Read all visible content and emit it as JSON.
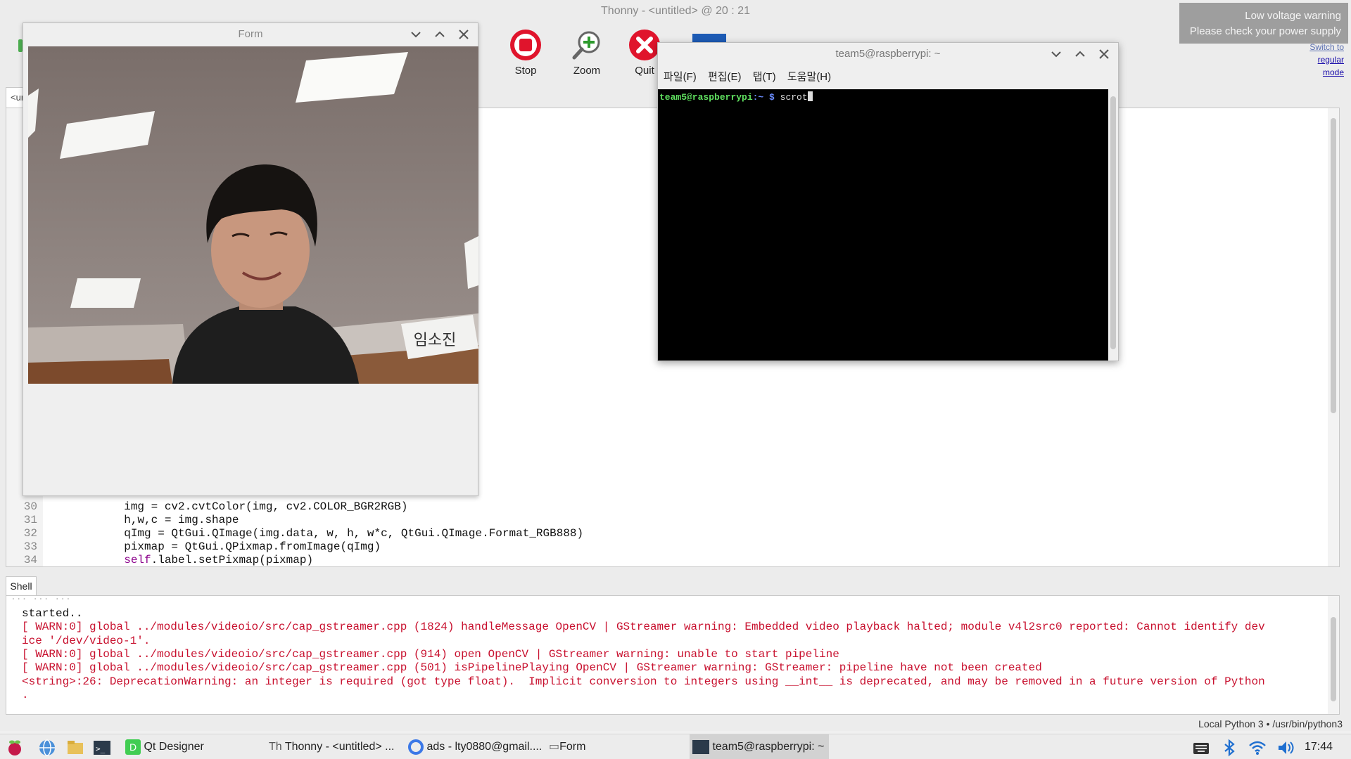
{
  "thonny": {
    "title": "Thonny  -  <untitled>  @  20 : 21",
    "toolbar": {
      "stop": "Stop",
      "zoom": "Zoom",
      "quit": "Quit"
    },
    "editor_tab": "<untitled>",
    "code": [
      {
        "n": "30",
        "text": "            img = cv2.cvtColor(img, cv2.COLOR_BGR2RGB)"
      },
      {
        "n": "31",
        "text": "            h,w,c = img.shape"
      },
      {
        "n": "32",
        "text": "            qImg = QtGui.QImage(img.data, w, h, w*c, QtGui.QImage.Format_RGB888)"
      },
      {
        "n": "33",
        "text": "            pixmap = QtGui.QPixmap.fromImage(qImg)"
      },
      {
        "n": "34",
        "kw": "self",
        "text": ".label.setPixmap(pixmap)"
      }
    ],
    "shell_tab": "Shell",
    "shell_lines": [
      {
        "cls": "plain",
        "text": "started.."
      },
      {
        "cls": "red",
        "text": "[ WARN:0] global ../modules/videoio/src/cap_gstreamer.cpp (1824) handleMessage OpenCV | GStreamer warning: Embedded video playback halted; module v4l2src0 reported: Cannot identify dev"
      },
      {
        "cls": "red",
        "text": "ice '/dev/video-1'."
      },
      {
        "cls": "red",
        "text": "[ WARN:0] global ../modules/videoio/src/cap_gstreamer.cpp (914) open OpenCV | GStreamer warning: unable to start pipeline"
      },
      {
        "cls": "red",
        "text": "[ WARN:0] global ../modules/videoio/src/cap_gstreamer.cpp (501) isPipelinePlaying OpenCV | GStreamer warning: GStreamer: pipeline have not been created"
      },
      {
        "cls": "red",
        "text": "<string>:26: DeprecationWarning: an integer is required (got type float).  Implicit conversion to integers using __int__ is deprecated, and may be removed in a future version of Python"
      },
      {
        "cls": "red",
        "text": "."
      }
    ],
    "status": "Local Python 3  •  /usr/bin/python3",
    "mode_links": [
      "Switch to",
      "regular",
      "mode"
    ]
  },
  "warning": {
    "line1": "Low voltage warning",
    "line2": "Please check your power supply"
  },
  "form": {
    "title": "Form",
    "photo_sign": "임소진"
  },
  "terminal": {
    "title": "team5@raspberrypi: ~",
    "menu": [
      "파일(F)",
      "편집(E)",
      "탭(T)",
      "도움말(H)"
    ],
    "prompt_user": "team5@raspberrypi",
    "prompt_path": ":~ $",
    "command": "scrot"
  },
  "taskbar": {
    "tasks": [
      "Qt Designer",
      "Thonny  -  <untitled>  ...",
      "ads - lty0880@gmail....",
      "Form",
      "team5@raspberrypi: ~"
    ],
    "clock": "17:44"
  },
  "colors": {
    "error_red": "#c8102e",
    "stop_red": "#e0142c",
    "term_green": "#5fe05f"
  }
}
